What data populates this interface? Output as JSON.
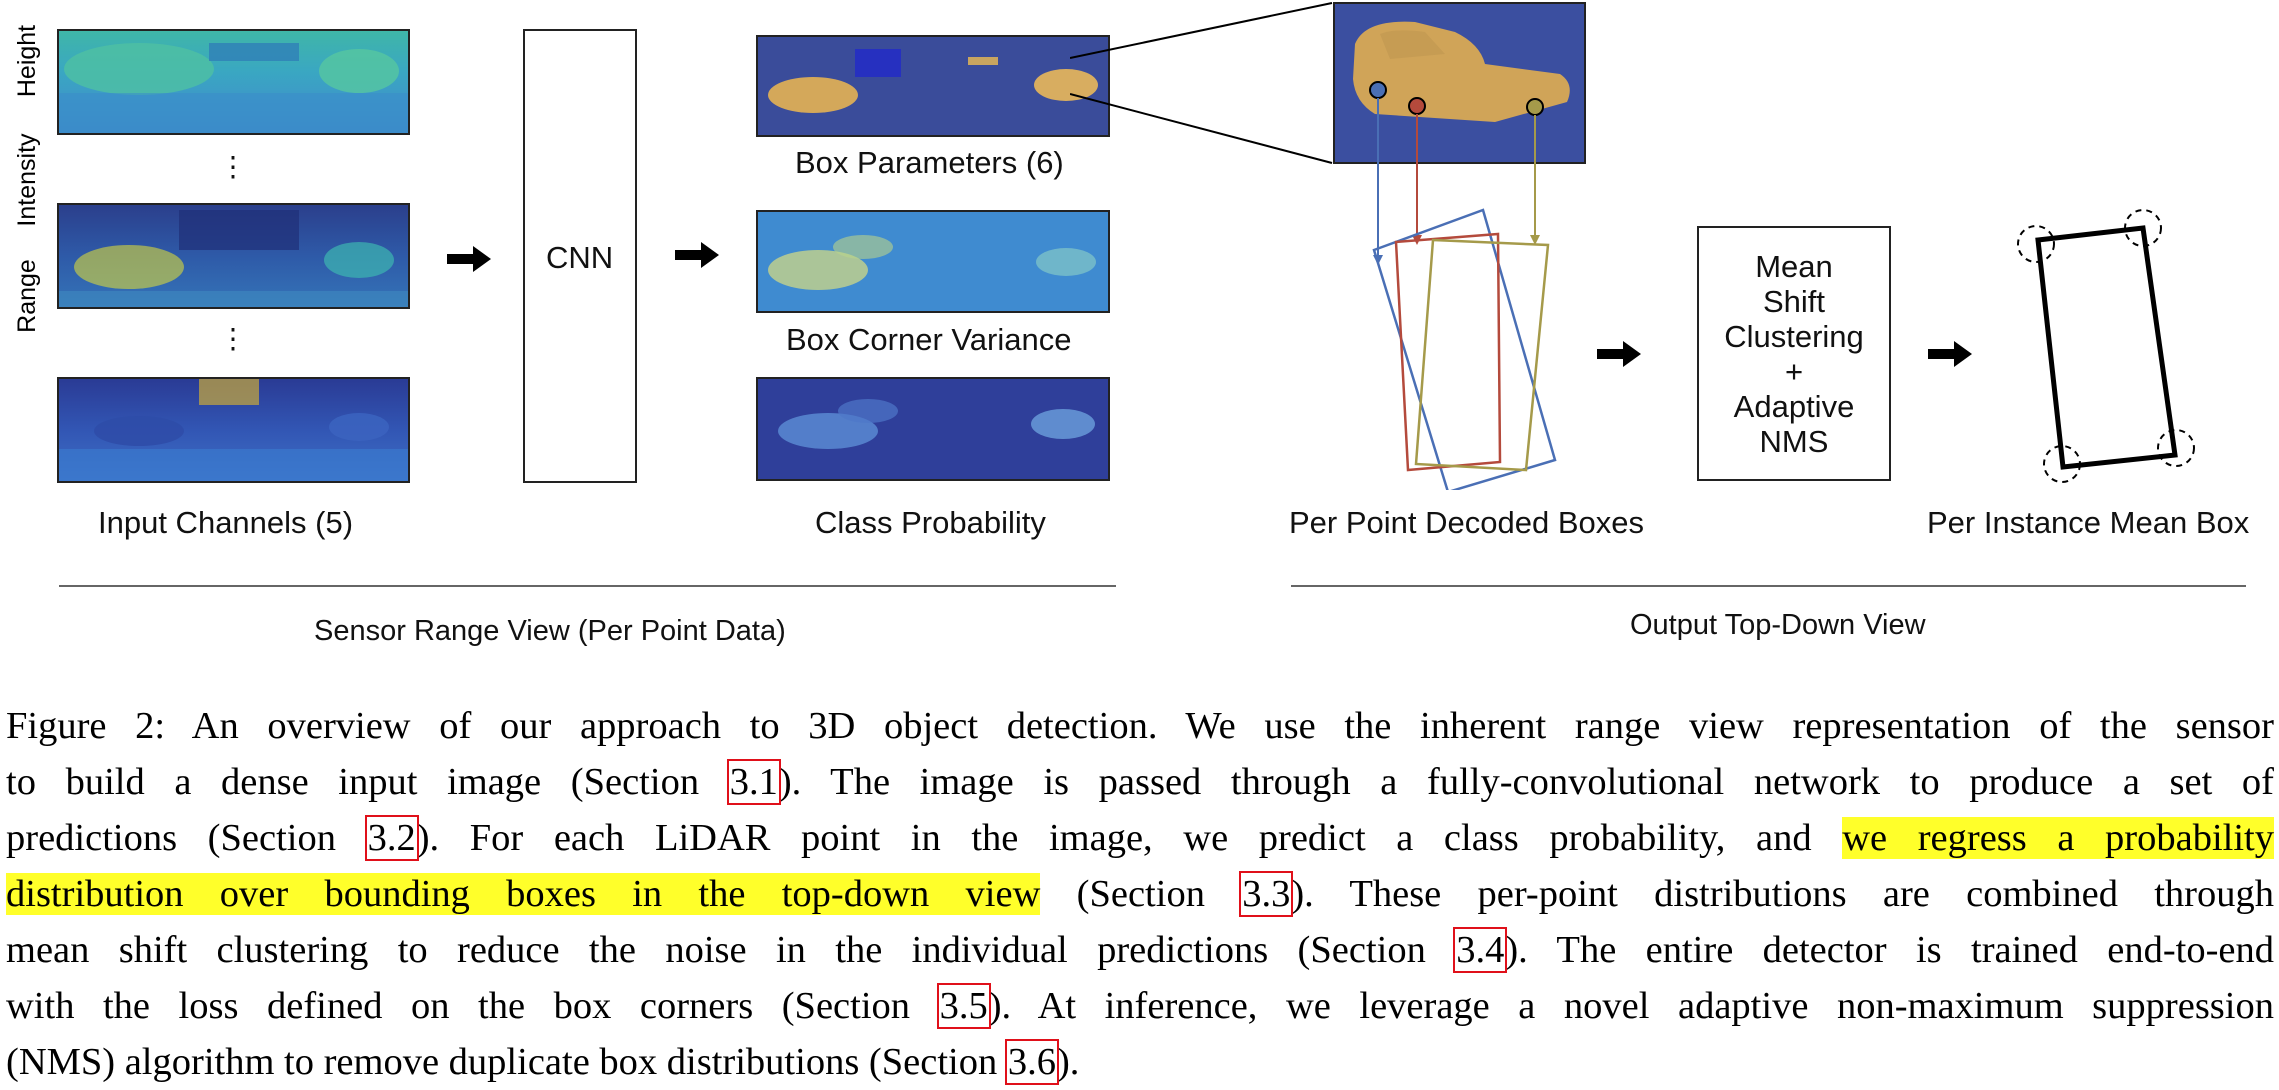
{
  "figure": {
    "input_channel_labels": [
      "Height",
      "Intensity",
      "Range"
    ],
    "ellipsis": "⋮",
    "input_title": "Input Channels (5)",
    "cnn_label": "CNN",
    "output_labels": {
      "box_params": "Box Parameters (6)",
      "corner_variance": "Box Corner Variance",
      "class_prob": "Class Probability"
    },
    "decoded_label": "Per Point Decoded Boxes",
    "clustering_lines": [
      "Mean",
      "Shift",
      "Clustering",
      "+",
      "Adaptive",
      "NMS"
    ],
    "mean_box_label": "Per Instance Mean Box",
    "section_left": "Sensor Range View (Per Point Data)",
    "section_right": "Output Top-Down View",
    "colors": {
      "ref_box": "#e0101a",
      "highlight": "#ffff2a",
      "box_blue": "#4a6fb5",
      "box_red": "#b44a3c",
      "box_olive": "#a59a4a"
    }
  },
  "caption": {
    "line1": {
      "text": "Figure 2: An overview of our approach to 3D object detection. We use the inherent range view representation of the sensor"
    },
    "line2": {
      "a": "to build a dense input image (Section ",
      "ref": "3.1",
      "b": "). The image is passed through a fully-convolutional network to produce a set of"
    },
    "line3": {
      "a": "predictions (Section ",
      "ref": "3.2",
      "b": "). For each LiDAR point in the image, we predict a class probability, and ",
      "hl": "we regress a probability"
    },
    "line4": {
      "hl": "distribution over bounding boxes in the top-down view",
      "a": " (Section ",
      "ref": "3.3",
      "b": "). These per-point distributions are combined through"
    },
    "line5": {
      "a": "mean shift clustering to reduce the noise in the individual predictions (Section ",
      "ref": "3.4",
      "b": "). The entire detector is trained end-to-end"
    },
    "line6": {
      "a": "with the loss defined on the box corners (Section ",
      "ref": "3.5",
      "b": "). At inference, we leverage a novel adaptive non-maximum suppression"
    },
    "line7": {
      "a": "(NMS) algorithm to remove duplicate box distributions (Section ",
      "ref": "3.6",
      "b": ")."
    }
  }
}
